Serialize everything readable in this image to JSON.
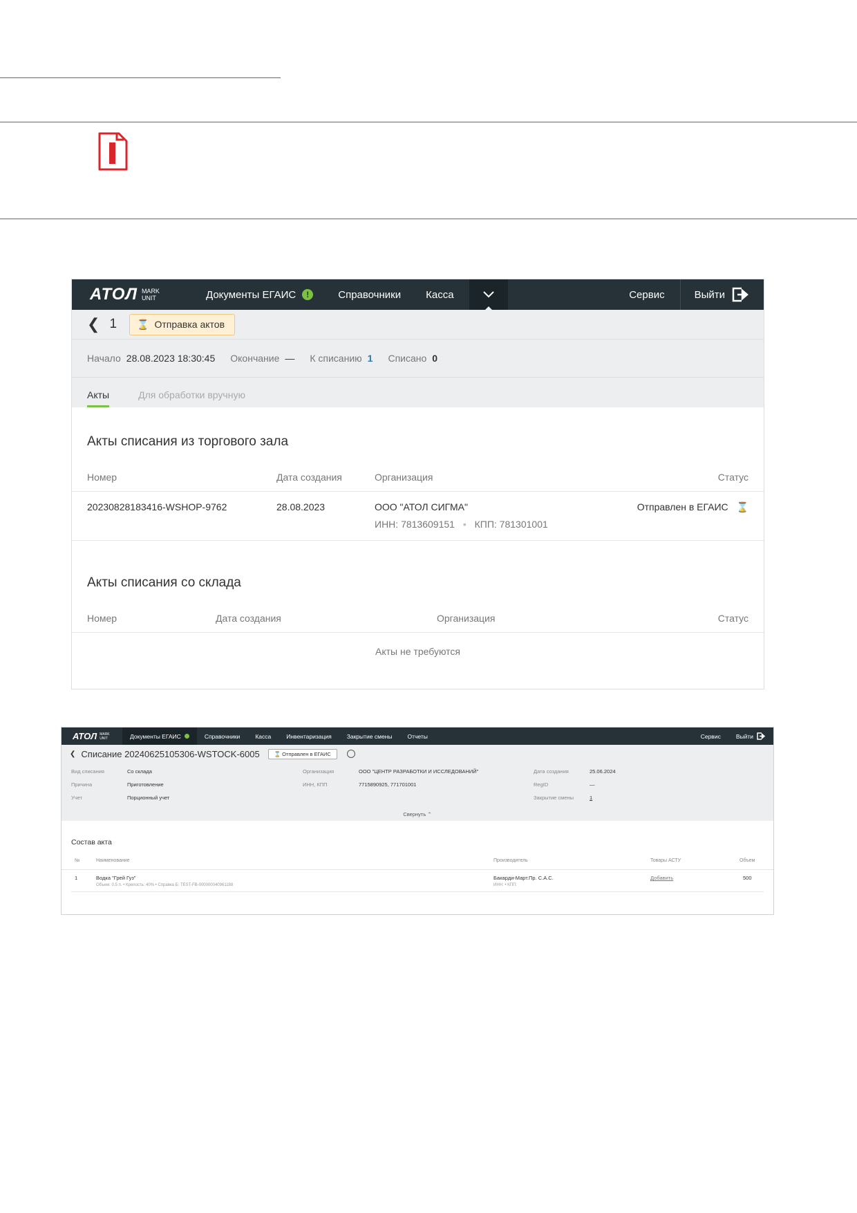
{
  "shot1": {
    "logo": {
      "main": "ATOЛ",
      "sub1": "MARK",
      "sub2": "UNIT"
    },
    "nav": {
      "documents": "Документы ЕГАИС",
      "badge": "!",
      "references": "Справочники",
      "kassa": "Касса",
      "service": "Сервис",
      "logout": "Выйти"
    },
    "title": {
      "number": "1",
      "status": "Отправка актов"
    },
    "info": {
      "start_label": "Начало",
      "start_value": "28.08.2023 18:30:45",
      "end_label": "Окончание",
      "end_value": "—",
      "to_write_label": "К списанию",
      "to_write_value": "1",
      "written_label": "Списано",
      "written_value": "0"
    },
    "tabs": {
      "acts": "Акты",
      "manual": "Для обработки вручную"
    },
    "section1": {
      "title": "Акты списания из торгового зала",
      "columns": {
        "number": "Номер",
        "date": "Дата создания",
        "org": "Организация",
        "status": "Статус"
      },
      "rows": [
        {
          "number": "20230828183416-WSHOP-9762",
          "date": "28.08.2023",
          "org": "ООО \"АТОЛ СИГМА\"",
          "inn": "ИНН: 7813609151",
          "kpp": "КПП: 781301001",
          "status": "Отправлен в ЕГАИС"
        }
      ]
    },
    "section2": {
      "title": "Акты списания со склада",
      "columns": {
        "number": "Номер",
        "date": "Дата создания",
        "org": "Организация",
        "status": "Статус"
      },
      "empty": "Акты не требуются"
    }
  },
  "shot2": {
    "logo": {
      "main": "ATOЛ",
      "sub1": "MARK",
      "sub2": "UNIT"
    },
    "nav": {
      "documents": "Документы ЕГАИС",
      "references": "Справочники",
      "kassa": "Касса",
      "inventory": "Инвентаризация",
      "shift_close": "Закрытие смены",
      "reports": "Отчеты",
      "service": "Сервис",
      "logout": "Выйти"
    },
    "title": "Списание 20240625105306-WSTOCK-6005",
    "status_button": "Отправлен в ЕГАИС",
    "fields": {
      "type_label": "Вид списания",
      "type_value": "Со склада",
      "reason_label": "Причина",
      "reason_value": "Приготовление",
      "account_label": "Учет",
      "account_value": "Порционный учет",
      "org_label": "Организация",
      "org_value": "ООО \"ЦЕНТР РАЗРАБОТКИ И ИССЛЕДОВАНИЙ\"",
      "innkpp_label": "ИНН, КПП",
      "innkpp_value": "7715890925, 771701001",
      "created_label": "Дата создания",
      "created_value": "25.06.2024",
      "regid_label": "RegID",
      "regid_value": "—",
      "shift_label": "Закрытие смены",
      "shift_value": "1"
    },
    "collapse": "Свернуть",
    "composition": {
      "title": "Состав акта",
      "columns": {
        "n": "№",
        "name": "Наименование",
        "producer": "Производитель",
        "astu": "Товары АСТУ",
        "volume": "Объем"
      },
      "rows": [
        {
          "n": "1",
          "name": "Водка \"Грей Гуз\"",
          "details": "Объем: 0.5 л. • Крепость: 40% • Справка Б: TEST-FB-000000040961188",
          "producer": "Бакарди-Март.Пр. С.А.С.",
          "producer_sub": "ИНН: • КПП:",
          "astu": "Добавить",
          "volume": "500"
        }
      ]
    }
  }
}
